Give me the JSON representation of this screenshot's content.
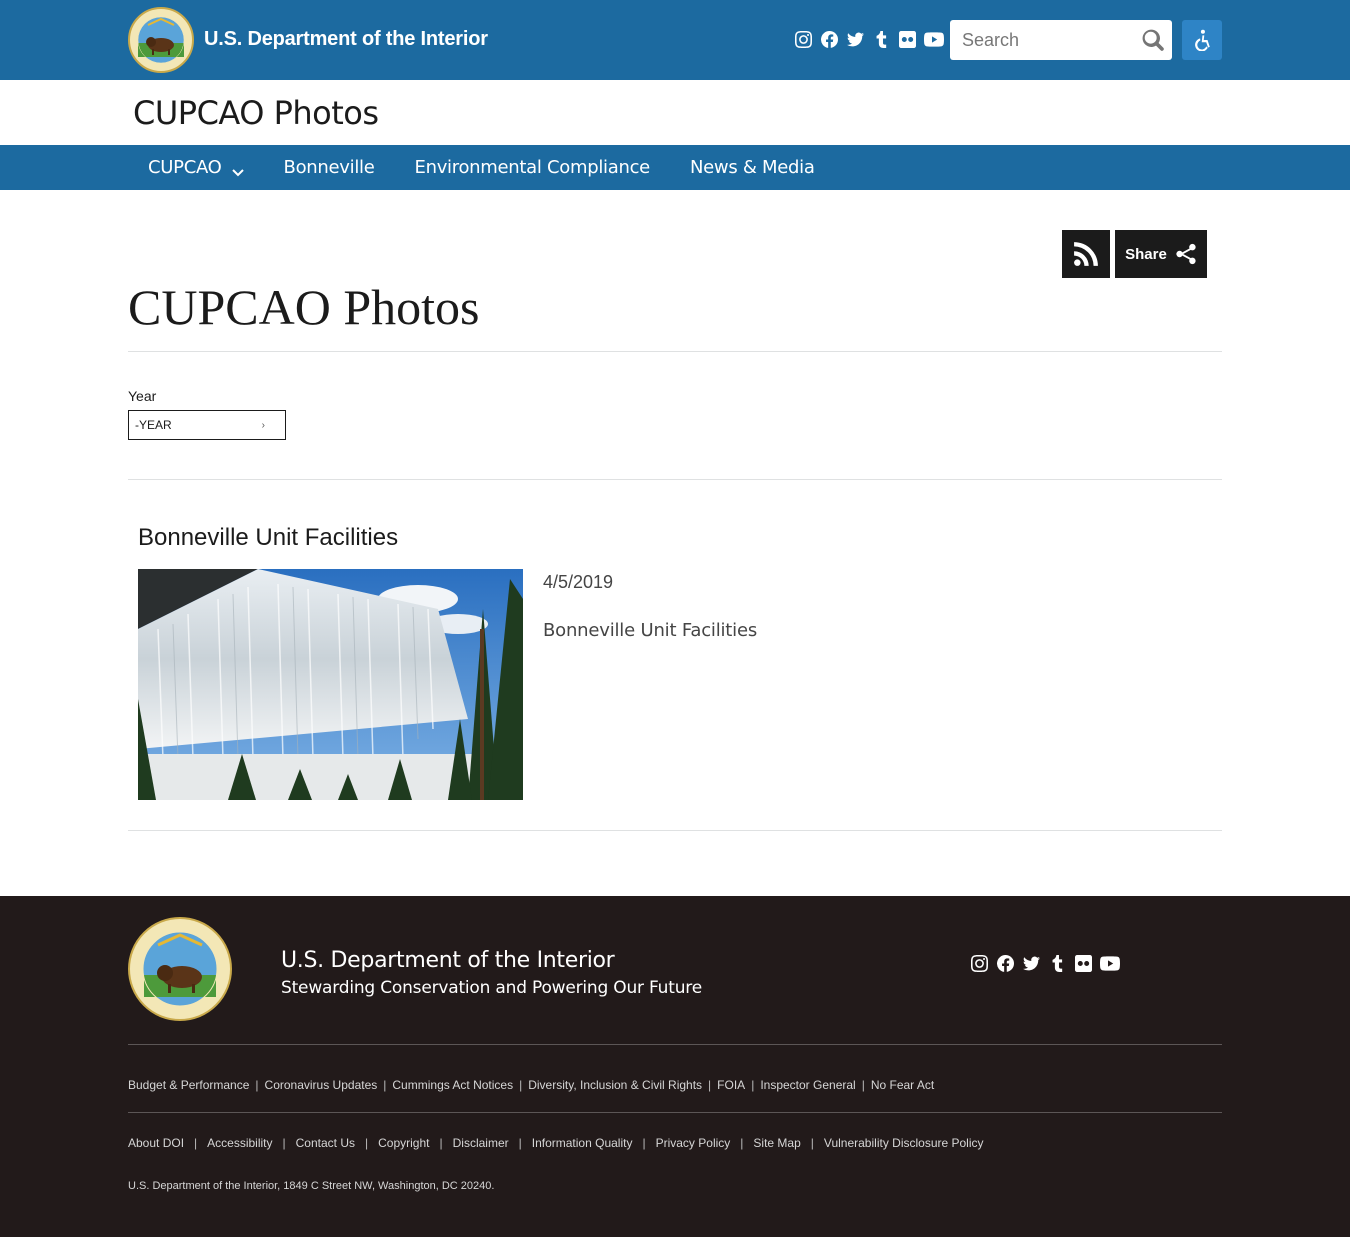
{
  "header": {
    "agency_name": "U.S. Department of the Interior",
    "seal_text": "U.S. DEPARTMENT OF THE INTERIOR · MARCH 3, 1849",
    "social_icons": [
      "instagram-icon",
      "facebook-icon",
      "twitter-icon",
      "tumblr-icon",
      "flickr-icon",
      "youtube-icon"
    ],
    "search_placeholder": "Search",
    "colors": {
      "bar": "#1c6aa0",
      "accessibility_button": "#2e84c6"
    }
  },
  "site": {
    "title": "CUPCAO Photos"
  },
  "nav": {
    "items": [
      {
        "label": "CUPCAO",
        "has_dropdown": true
      },
      {
        "label": "Bonneville"
      },
      {
        "label": "Environmental Compliance"
      },
      {
        "label": "News & Media"
      }
    ]
  },
  "page": {
    "share_label": "Share",
    "heading": "CUPCAO Photos",
    "year_filter": {
      "label": "Year",
      "selected": "-YEAR"
    },
    "items": [
      {
        "title": "Bonneville Unit Facilities",
        "date": "4/5/2019",
        "description": "Bonneville Unit Facilities"
      }
    ]
  },
  "footer": {
    "agency_name": "U.S. Department of the Interior",
    "tagline": "Stewarding Conservation and Powering Our Future",
    "links_row1": [
      "Budget & Performance",
      "Coronavirus Updates",
      "Cummings Act Notices",
      "Diversity, Inclusion & Civil Rights",
      "FOIA",
      "Inspector General",
      "No Fear Act"
    ],
    "links_row2": [
      "About DOI",
      "Accessibility",
      "Contact Us",
      "Copyright",
      "Disclaimer",
      "Information Quality",
      "Privacy Policy",
      "Site Map",
      "Vulnerability Disclosure Policy"
    ],
    "address": "U.S. Department of the Interior, 1849 C Street NW, Washington, DC 20240.",
    "colors": {
      "background": "#221a1a"
    }
  }
}
